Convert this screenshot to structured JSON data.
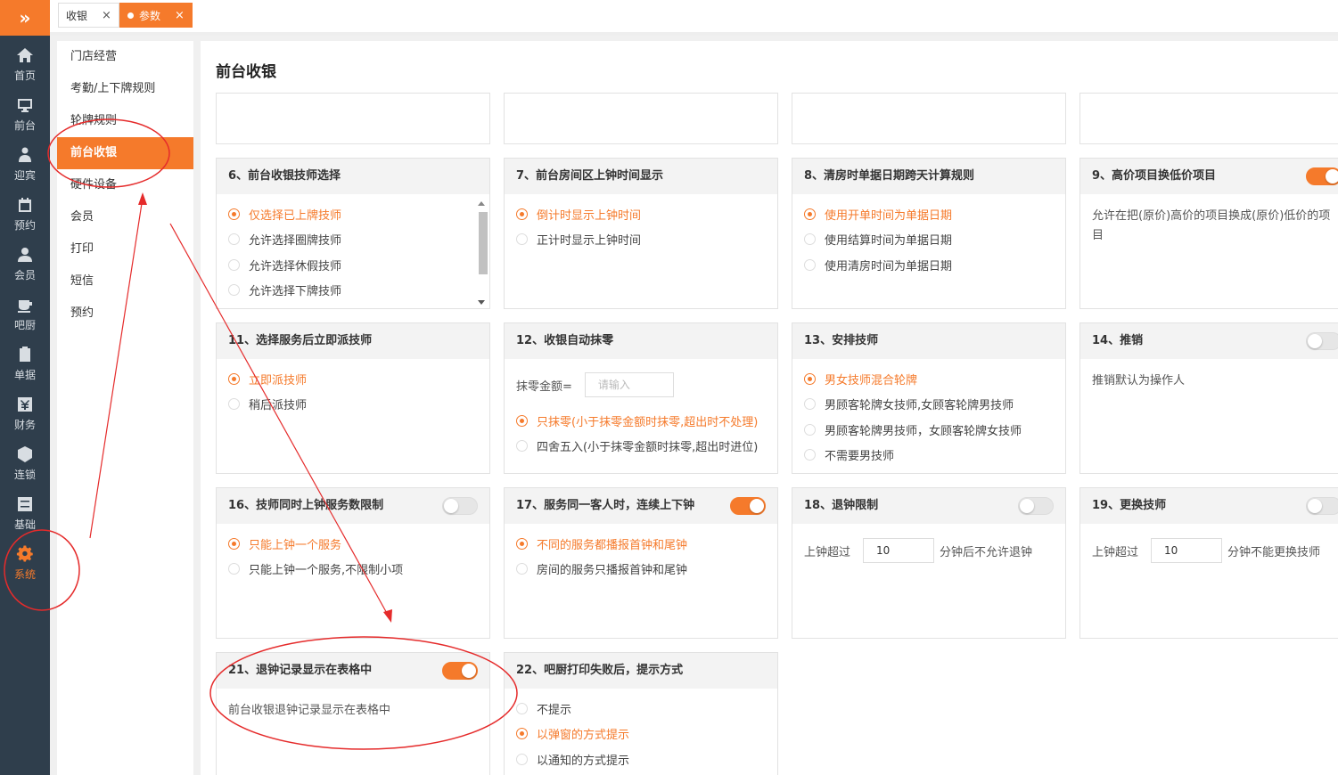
{
  "app": {
    "logo_glyph": "»",
    "accent_color": "#f57a2b",
    "sidebar_color": "#2f3e4c"
  },
  "nav": [
    {
      "label": "首页",
      "icon": "home-icon"
    },
    {
      "label": "前台",
      "icon": "monitor-icon"
    },
    {
      "label": "迎宾",
      "icon": "greeter-icon"
    },
    {
      "label": "预约",
      "icon": "calendar-icon"
    },
    {
      "label": "会员",
      "icon": "user-icon"
    },
    {
      "label": "吧厨",
      "icon": "cup-icon"
    },
    {
      "label": "单据",
      "icon": "document-icon"
    },
    {
      "label": "财务",
      "icon": "yuan-icon"
    },
    {
      "label": "连锁",
      "icon": "box-icon"
    },
    {
      "label": "基础",
      "icon": "sliders-icon"
    },
    {
      "label": "系统",
      "icon": "gear-icon"
    }
  ],
  "tabs": [
    {
      "label": "收银",
      "close": "×"
    },
    {
      "label": "参数",
      "close": "×"
    }
  ],
  "submenu": [
    "门店经营",
    "考勤/上下牌规则",
    "轮牌规则",
    "前台收银",
    "硬件设备",
    "会员",
    "打印",
    "短信",
    "预约"
  ],
  "page_title": "前台收银",
  "cards": {
    "c6": {
      "title": "6、前台收银技师选择",
      "options": [
        "仅选择已上牌技师",
        "允许选择圈牌技师",
        "允许选择休假技师",
        "允许选择下牌技师"
      ]
    },
    "c7": {
      "title": "7、前台房间区上钟时间显示",
      "options": [
        "倒计时显示上钟时间",
        "正计时显示上钟时间"
      ]
    },
    "c8": {
      "title": "8、清房时单据日期跨天计算规则",
      "options": [
        "使用开单时间为单据日期",
        "使用结算时间为单据日期",
        "使用清房时间为单据日期"
      ]
    },
    "c9": {
      "title": "9、高价项目换低价项目",
      "desc": "允许在把(原价)高价的项目换成(原价)低价的项目"
    },
    "c11": {
      "title": "11、选择服务后立即派技师",
      "options": [
        "立即派技师",
        "稍后派技师"
      ]
    },
    "c12": {
      "title": "12、收银自动抹零",
      "field_label": "抹零金额=",
      "field_placeholder": "请输入",
      "options": [
        "只抹零(小于抹零金额时抹零,超出时不处理)",
        "四舍五入(小于抹零金额时抹零,超出时进位)"
      ]
    },
    "c13": {
      "title": "13、安排技师",
      "options": [
        "男女技师混合轮牌",
        "男顾客轮牌女技师,女顾客轮牌男技师",
        "男顾客轮牌男技师，女顾客轮牌女技师",
        "不需要男技师"
      ]
    },
    "c14": {
      "title": "14、推销",
      "desc": "推销默认为操作人"
    },
    "c16": {
      "title": "16、技师同时上钟服务数限制",
      "options": [
        "只能上钟一个服务",
        "只能上钟一个服务,不限制小项"
      ]
    },
    "c17": {
      "title": "17、服务同一客人时，连续上下钟",
      "options": [
        "不同的服务都播报首钟和尾钟",
        "房间的服务只播报首钟和尾钟"
      ]
    },
    "c18": {
      "title": "18、退钟限制",
      "prefix": "上钟超过",
      "value": "10",
      "suffix": "分钟后不允许退钟"
    },
    "c19": {
      "title": "19、更换技师",
      "prefix": "上钟超过",
      "value": "10",
      "suffix": "分钟不能更换技师"
    },
    "c21": {
      "title": "21、退钟记录显示在表格中",
      "desc": "前台收银退钟记录显示在表格中"
    },
    "c22": {
      "title": "22、吧厨打印失败后，提示方式",
      "options": [
        "不提示",
        "以弹窗的方式提示",
        "以通知的方式提示"
      ]
    }
  }
}
